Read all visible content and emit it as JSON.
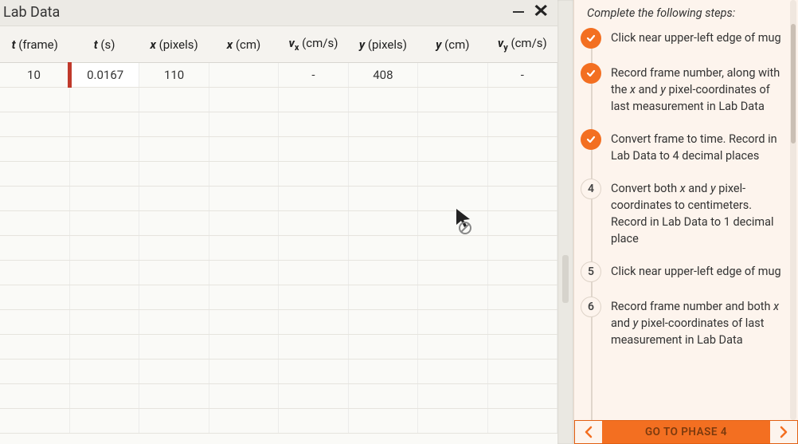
{
  "window": {
    "title": "Lab Data"
  },
  "table": {
    "headers": [
      {
        "var": "t",
        "sub": "",
        "unit": "(frame)"
      },
      {
        "var": "t",
        "sub": "",
        "unit": "(s)"
      },
      {
        "var": "x",
        "sub": "",
        "unit": "(pixels)"
      },
      {
        "var": "x",
        "sub": "",
        "unit": "(cm)"
      },
      {
        "var": "v",
        "sub": "x",
        "unit": "(cm/s)"
      },
      {
        "var": "y",
        "sub": "",
        "unit": "(pixels)"
      },
      {
        "var": "y",
        "sub": "",
        "unit": "(cm)"
      },
      {
        "var": "v",
        "sub": "y",
        "unit": "(cm/s)"
      }
    ],
    "rows": [
      [
        "10",
        "0.0167",
        "110",
        "",
        "-",
        "408",
        "",
        "-"
      ],
      [
        "",
        "",
        "",
        "",
        "",
        "",
        "",
        ""
      ],
      [
        "",
        "",
        "",
        "",
        "",
        "",
        "",
        ""
      ],
      [
        "",
        "",
        "",
        "",
        "",
        "",
        "",
        ""
      ],
      [
        "",
        "",
        "",
        "",
        "",
        "",
        "",
        ""
      ],
      [
        "",
        "",
        "",
        "",
        "",
        "",
        "",
        ""
      ],
      [
        "",
        "",
        "",
        "",
        "",
        "",
        "",
        ""
      ],
      [
        "",
        "",
        "",
        "",
        "",
        "",
        "",
        ""
      ],
      [
        "",
        "",
        "",
        "",
        "",
        "",
        "",
        ""
      ],
      [
        "",
        "",
        "",
        "",
        "",
        "",
        "",
        ""
      ],
      [
        "",
        "",
        "",
        "",
        "",
        "",
        "",
        ""
      ],
      [
        "",
        "",
        "",
        "",
        "",
        "",
        "",
        ""
      ],
      [
        "",
        "",
        "",
        "",
        "",
        "",
        "",
        ""
      ],
      [
        "",
        "",
        "",
        "",
        "",
        "",
        "",
        ""
      ],
      [
        "",
        "",
        "",
        "",
        "",
        "",
        "",
        ""
      ]
    ],
    "active_row": 0,
    "active_col": 1
  },
  "instructions": {
    "header": "Complete the following steps:",
    "steps": [
      {
        "done": true,
        "num": "",
        "text": "Click near upper-left edge of mug"
      },
      {
        "done": true,
        "num": "",
        "text": "Record frame number, along with the x and y pixel-coordinates of last measurement in Lab Data"
      },
      {
        "done": true,
        "num": "",
        "text": "Convert frame to time. Record in Lab Data to 4 decimal places"
      },
      {
        "done": false,
        "num": "4",
        "text": "Convert both x and y pixel-coordinates to centimeters. Record in Lab Data to 1 decimal place"
      },
      {
        "done": false,
        "num": "5",
        "text": "Click near upper-left edge of mug"
      },
      {
        "done": false,
        "num": "6",
        "text": "Record frame number and both x and y pixel-coordinates of last measurement in Lab Data"
      }
    ]
  },
  "footer": {
    "label": "GO TO PHASE 4"
  },
  "colors": {
    "accent": "#f36f21",
    "cell_marker": "#c0392b"
  }
}
